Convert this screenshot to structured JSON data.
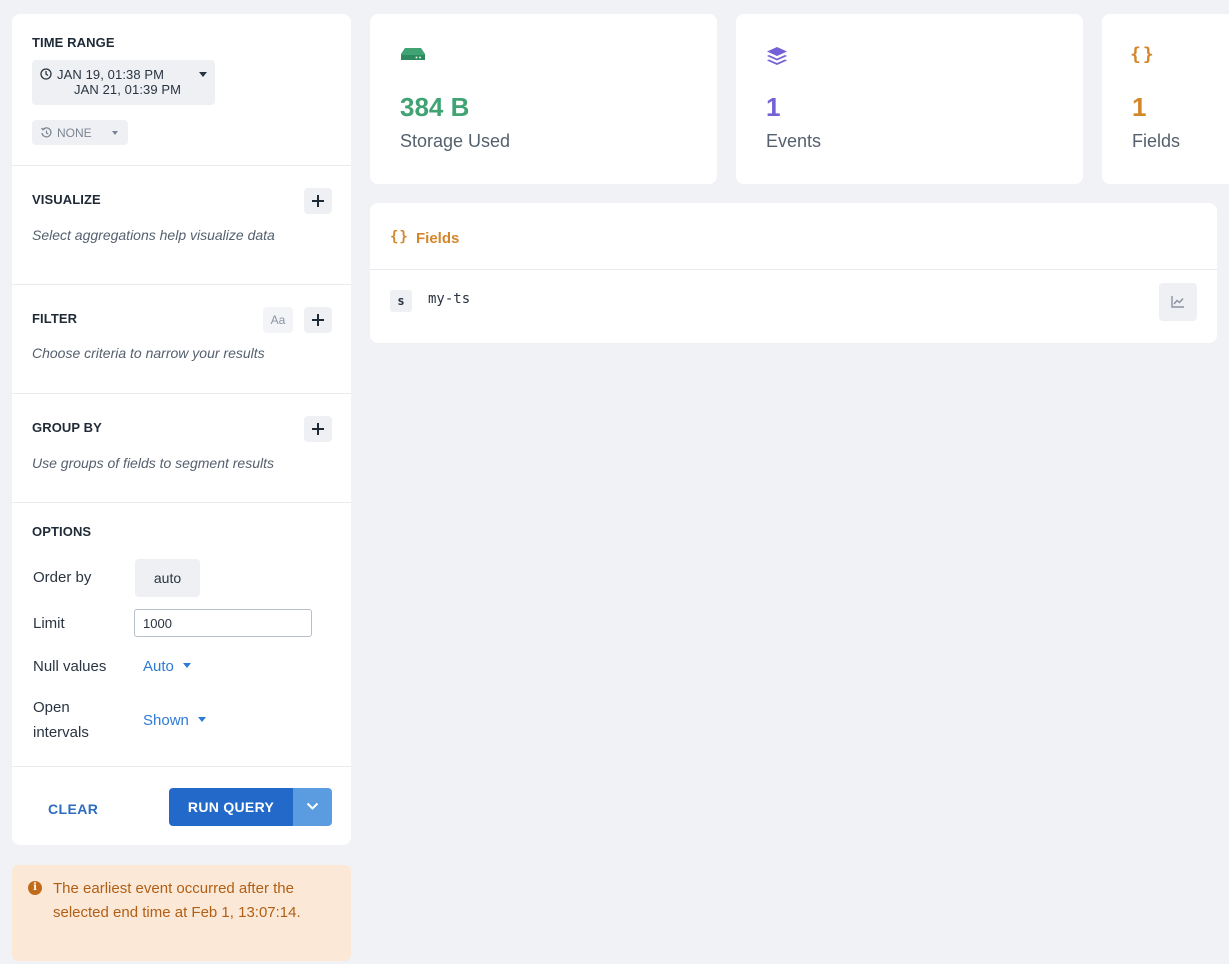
{
  "query_panel": {
    "time_range": {
      "title": "TIME RANGE",
      "start": "JAN 19, 01:38 PM",
      "end": "JAN 21, 01:39 PM",
      "compare": "NONE"
    },
    "visualize": {
      "title": "VISUALIZE",
      "description": "Select aggregations help visualize data"
    },
    "filter": {
      "title": "FILTER",
      "case_toggle": "Aa",
      "description": "Choose criteria to narrow your results"
    },
    "group_by": {
      "title": "GROUP BY",
      "description": "Use groups of fields to segment results"
    },
    "options": {
      "title": "OPTIONS",
      "order_by_label": "Order by",
      "order_by_value": "auto",
      "limit_label": "Limit",
      "limit_value": "1000",
      "null_values_label": "Null values",
      "null_values_value": "Auto",
      "open_intervals_label_1": "Open",
      "open_intervals_label_2": "intervals",
      "open_intervals_value": "Shown"
    },
    "actions": {
      "clear": "CLEAR",
      "run_query": "RUN QUERY"
    }
  },
  "notice": {
    "text": "The earliest event occurred after the selected end time at Feb 1, 13:07:14."
  },
  "stats": [
    {
      "value": "384 B",
      "label": "Storage Used",
      "color": "#3fa373",
      "icon": "hard-drive-icon"
    },
    {
      "value": "1",
      "label": "Events",
      "color": "#7461d6",
      "icon": "layers-icon"
    },
    {
      "value": "1",
      "label": "Fields",
      "color": "#d4862a",
      "icon": "braces-icon"
    }
  ],
  "fields_panel": {
    "title": "Fields",
    "fields": [
      {
        "type": "s",
        "name": "my-ts"
      }
    ]
  },
  "colors": {
    "background": "#f1f2f6",
    "primary": "#2269c9",
    "link": "#2d7bd6",
    "warning_bg": "#fbe8d6",
    "warning_text": "#b05f16"
  }
}
